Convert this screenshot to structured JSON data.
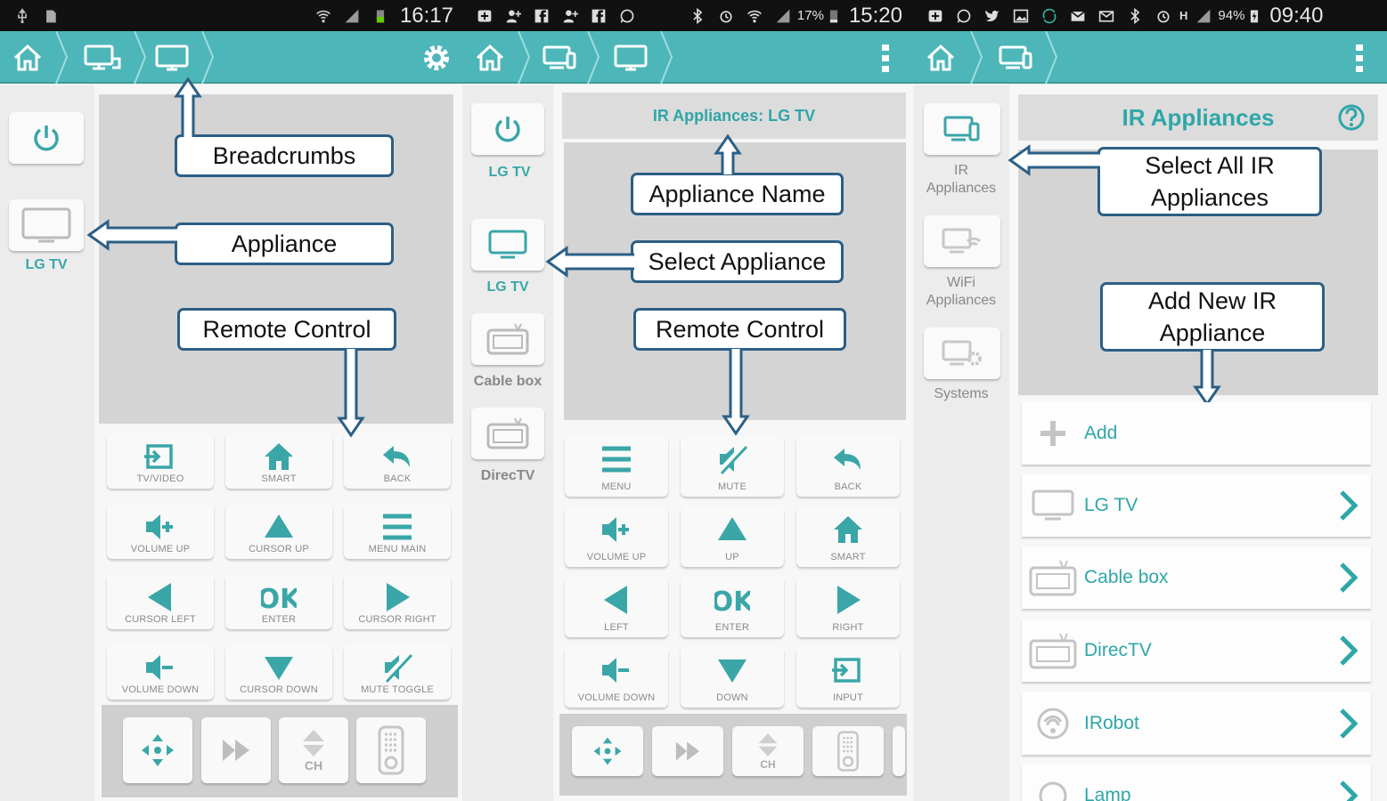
{
  "panels": [
    {
      "status": {
        "time": "16:17"
      },
      "sidebar": {
        "appliance_label": "LG TV"
      },
      "remote": {
        "buttons": [
          "TV/VIDEO",
          "SMART",
          "BACK",
          "VOLUME UP",
          "CURSOR UP",
          "MENU MAIN",
          "CURSOR LEFT",
          "ENTER",
          "CURSOR RIGHT",
          "VOLUME DOWN",
          "CURSOR DOWN",
          "MUTE TOGGLE"
        ],
        "ok_text": "OK",
        "ch_text": "CH"
      },
      "callouts": {
        "breadcrumbs": "Breadcrumbs",
        "appliance": "Appliance",
        "remote_control": "Remote Control"
      }
    },
    {
      "status": {
        "battery_pct": "17%",
        "time": "15:20"
      },
      "header": {
        "title": "IR Appliances: LG TV"
      },
      "sidebar": {
        "items": [
          "LG TV",
          "LG TV",
          "Cable box",
          "DirecTV"
        ]
      },
      "remote": {
        "buttons": [
          "MENU",
          "MUTE",
          "BACK",
          "VOLUME UP",
          "UP",
          "SMART",
          "LEFT",
          "ENTER",
          "RIGHT",
          "VOLUME DOWN",
          "DOWN",
          "INPUT"
        ],
        "ok_text": "OK",
        "ch_text": "CH"
      },
      "callouts": {
        "appliance_name": "Appliance Name",
        "select_appliance": "Select Appliance",
        "remote_control": "Remote Control"
      }
    },
    {
      "status": {
        "network": "H",
        "battery_pct": "94%",
        "time": "09:40"
      },
      "sidebar": {
        "items": [
          "IR\nAppliances",
          "WiFi\nAppliances",
          "Systems"
        ]
      },
      "header": {
        "title": "IR Appliances"
      },
      "list": [
        "Add",
        "LG TV",
        "Cable box",
        "DirecTV",
        "IRobot",
        "Lamp"
      ],
      "callouts": {
        "select_all": "Select All IR\nAppliances",
        "add_new": "Add New IR\nAppliance"
      }
    }
  ],
  "colors": {
    "accent": "#4db6b8",
    "teal_text": "#2fa6a8",
    "callout_border": "#2b5f86",
    "status_bar": "#111111"
  }
}
